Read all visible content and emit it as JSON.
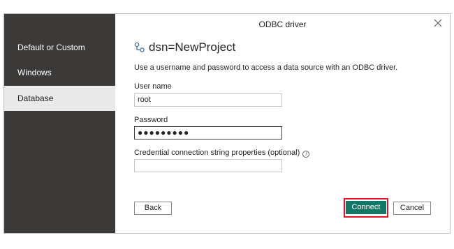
{
  "dialog": {
    "title": "ODBC driver",
    "heading": "dsn=NewProject",
    "description": "Use a username and password to access a data source with an ODBC driver.",
    "close_icon": "close-icon",
    "heading_icon": "link-icon"
  },
  "sidebar": {
    "items": [
      {
        "label": "Default or Custom",
        "active": false
      },
      {
        "label": "Windows",
        "active": false
      },
      {
        "label": "Database",
        "active": true
      }
    ]
  },
  "form": {
    "username_label": "User name",
    "username_value": "root",
    "password_label": "Password",
    "password_masked": "●●●●●●●●●",
    "credential_label": "Credential connection string properties (optional)",
    "credential_value": "",
    "info_icon": "info-icon"
  },
  "buttons": {
    "back": "Back",
    "connect": "Connect",
    "cancel": "Cancel"
  },
  "colors": {
    "sidebar_bg": "#3b3a39",
    "primary_button": "#117865",
    "highlight": "#e81123"
  }
}
